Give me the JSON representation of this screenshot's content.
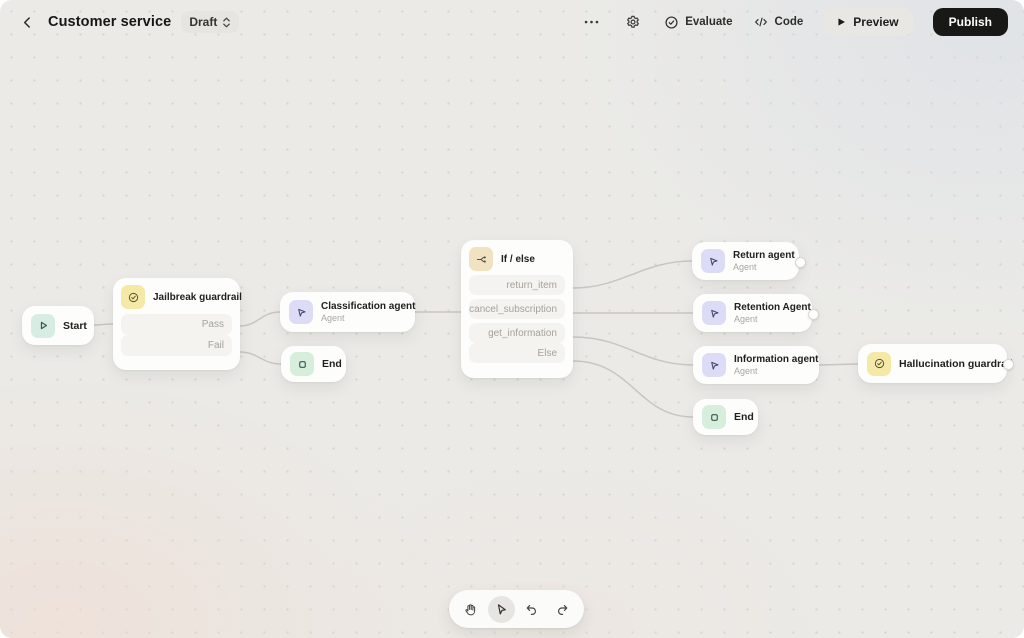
{
  "header": {
    "title": "Customer service",
    "status": "Draft",
    "evaluate_label": "Evaluate",
    "code_label": "Code",
    "preview_label": "Preview",
    "publish_label": "Publish"
  },
  "canvas": {
    "nodes": {
      "start": {
        "label": "Start",
        "type": "start"
      },
      "jailbreak_guardrail": {
        "title": "Jailbreak guardrail",
        "branches": [
          "Pass",
          "Fail"
        ],
        "type": "guardrail"
      },
      "classification_agent": {
        "title": "Classification agent",
        "subtitle": "Agent",
        "type": "agent"
      },
      "end_top": {
        "label": "End",
        "type": "end"
      },
      "if_else": {
        "title": "If / else",
        "branches": [
          "return_item",
          "cancel_subscription",
          "get_information",
          "Else"
        ],
        "type": "logic"
      },
      "return_agent": {
        "title": "Return agent",
        "subtitle": "Agent",
        "type": "agent"
      },
      "retention_agent": {
        "title": "Retention Agent",
        "subtitle": "Agent",
        "type": "agent"
      },
      "information_agent": {
        "title": "Information agent",
        "subtitle": "Agent",
        "type": "agent"
      },
      "end_bottom": {
        "label": "End",
        "type": "end"
      },
      "hallucination_guardrail": {
        "title": "Hallucination guardrail",
        "type": "guardrail"
      }
    },
    "edges": [
      {
        "from": "start",
        "to": "jailbreak_guardrail"
      },
      {
        "from": "jailbreak_guardrail.Pass",
        "to": "classification_agent"
      },
      {
        "from": "jailbreak_guardrail.Fail",
        "to": "end_top"
      },
      {
        "from": "classification_agent",
        "to": "if_else"
      },
      {
        "from": "if_else.return_item",
        "to": "return_agent"
      },
      {
        "from": "if_else.cancel_subscription",
        "to": "retention_agent"
      },
      {
        "from": "if_else.get_information",
        "to": "information_agent"
      },
      {
        "from": "if_else.Else",
        "to": "end_bottom"
      },
      {
        "from": "information_agent",
        "to": "hallucination_guardrail"
      }
    ]
  },
  "toolbar": {
    "tools": [
      "pan",
      "select",
      "undo",
      "redo"
    ],
    "active_tool": "select"
  },
  "colors": {
    "canvas_bg": "#ebeae7",
    "card_bg": "#fdfdfc",
    "row_bg": "#f4f3f0",
    "edge": "#c9c6c1",
    "publish_bg": "#181816",
    "preview_bg": "#e9e7e3",
    "start_icon_bg": "#d7ece3",
    "end_icon_bg": "#d8eedd",
    "agent_icon_bg": "#dddcf7",
    "guardrail_icon_bg": "#f4e9a6",
    "ifelse_icon_bg": "#f1e3c2"
  }
}
